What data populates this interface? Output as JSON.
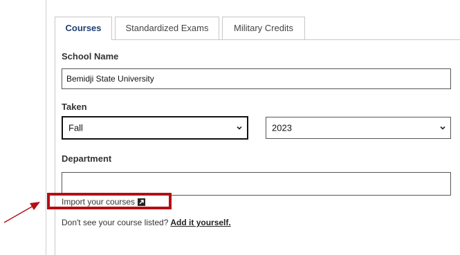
{
  "tabs": {
    "courses": "Courses",
    "exams": "Standardized Exams",
    "military": "Military Credits"
  },
  "school": {
    "label": "School Name",
    "value": "Bemidji State University"
  },
  "taken": {
    "label": "Taken",
    "term_value": "Fall",
    "year_value": "2023"
  },
  "department": {
    "label": "Department",
    "value": ""
  },
  "import": {
    "label": "Import your courses"
  },
  "help": {
    "text": "Don't see your course listed?",
    "link": "Add it yourself."
  },
  "icons": {
    "external": "external-link-icon",
    "chevron": "chevron-down-icon",
    "arrow": "annotation-arrow"
  },
  "colors": {
    "active_tab": "#1f3f72",
    "highlight": "#b30f14",
    "border": "#c7c7c7"
  }
}
